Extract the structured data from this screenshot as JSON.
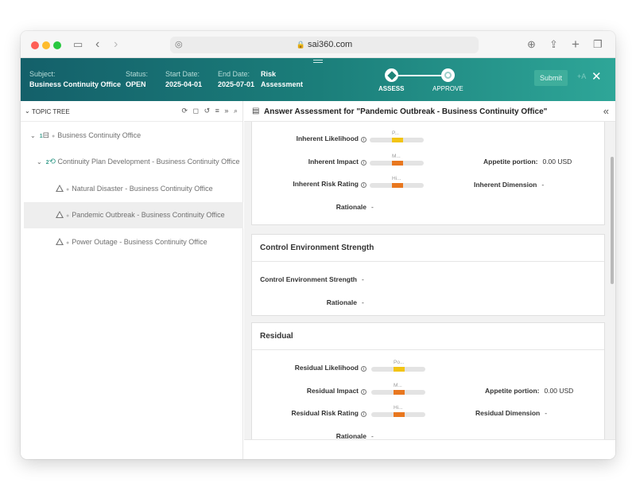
{
  "browser": {
    "url": "sai360.com"
  },
  "header": {
    "subject_label": "Subject:",
    "subject_value": "Business Continuity Office",
    "status_label": "Status:",
    "status_value": "OPEN",
    "start_label": "Start Date:",
    "start_value": "2025-04-01",
    "end_label": "End Date:",
    "end_value": "2025-07-01",
    "type_value_1": "Risk",
    "type_value_2": "Assessment",
    "steps": [
      "ASSESS",
      "APPROVE"
    ],
    "submit_label": "Submit",
    "more_label": "+A"
  },
  "tree": {
    "title": "TOPIC TREE",
    "nodes": [
      {
        "num": "1",
        "label": "Business Continuity Office"
      },
      {
        "num": "2",
        "label": "Continuity Plan Development - Business Continuity Office"
      },
      {
        "label": "Natural Disaster - Business Continuity Office"
      },
      {
        "label": "Pandemic Outbreak - Business Continuity Office"
      },
      {
        "label": "Power Outage - Business Continuity Office"
      }
    ]
  },
  "main": {
    "title": "Answer Assessment for \"Pandemic Outbreak - Business Continuity Office\"",
    "inherent": {
      "likelihood_label": "Inherent Likelihood",
      "likelihood_tag": "P...",
      "likelihood_level": 0.5,
      "impact_label": "Inherent Impact",
      "impact_tag": "M...",
      "impact_level": 0.5,
      "risk_label": "Inherent Risk Rating",
      "risk_tag": "Hi...",
      "risk_level": 0.5,
      "rationale_label": "Rationale",
      "rationale_value": "-",
      "appetite_label": "Appetite portion:",
      "appetite_value": "0.00 USD",
      "dimension_label": "Inherent Dimension",
      "dimension_value": "-"
    },
    "control": {
      "title": "Control Environment Strength",
      "strength_label": "Control Environment Strength",
      "strength_value": "-",
      "rationale_label": "Rationale",
      "rationale_value": "-"
    },
    "residual": {
      "title": "Residual",
      "likelihood_label": "Residual Likelihood",
      "likelihood_tag": "Po...",
      "impact_label": "Residual Impact",
      "impact_tag": "M...",
      "risk_label": "Residual Risk Rating",
      "risk_tag": "Hi...",
      "appetite_label": "Appetite portion:",
      "appetite_value": "0.00 USD",
      "dimension_label": "Residual Dimension",
      "dimension_value": "-",
      "rationale_label": "Rationale",
      "rationale_value": "-"
    }
  },
  "colors": {
    "teal_dark": "#14606a",
    "teal_light": "#2ea698",
    "likelihood_yellow": "#f2c416",
    "impact_orange": "#e8771f"
  }
}
